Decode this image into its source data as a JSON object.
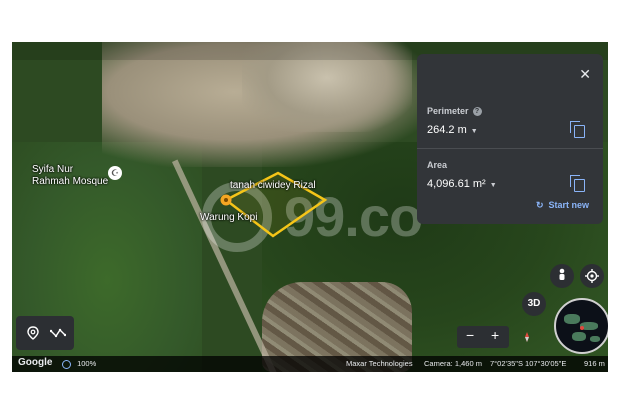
{
  "map": {
    "place_mosque_line1": "Syifa Nur",
    "place_mosque_line2": "Rahmah Mosque",
    "place_warung": "Warung Kopi",
    "polygon_label": "tanah ciwidey Rizal",
    "polygon_color": "#f5c518",
    "pin_color": "#f5a623"
  },
  "watermark": {
    "text": "99.co"
  },
  "measure_panel": {
    "close_label": "✕",
    "perimeter_label": "Perimeter",
    "perimeter_value": "264.2 m",
    "area_label": "Area",
    "area_value": "4,096.61 m²",
    "start_new_label": "Start new",
    "caret": "▼",
    "help": "?"
  },
  "controls": {
    "pegman_icon": "person-icon",
    "locate_icon": "target-icon",
    "view_3d_label": "3D",
    "zoom_out": "−",
    "zoom_in": "+",
    "compass_icon": "compass-icon"
  },
  "footer": {
    "brand": "Google",
    "zoom_percent": "100%",
    "attribution": "Maxar Technologies",
    "camera": "Camera: 1,460 m",
    "coordinates": "7°02'35\"S 107°30'05\"E",
    "scale": "916 m"
  }
}
